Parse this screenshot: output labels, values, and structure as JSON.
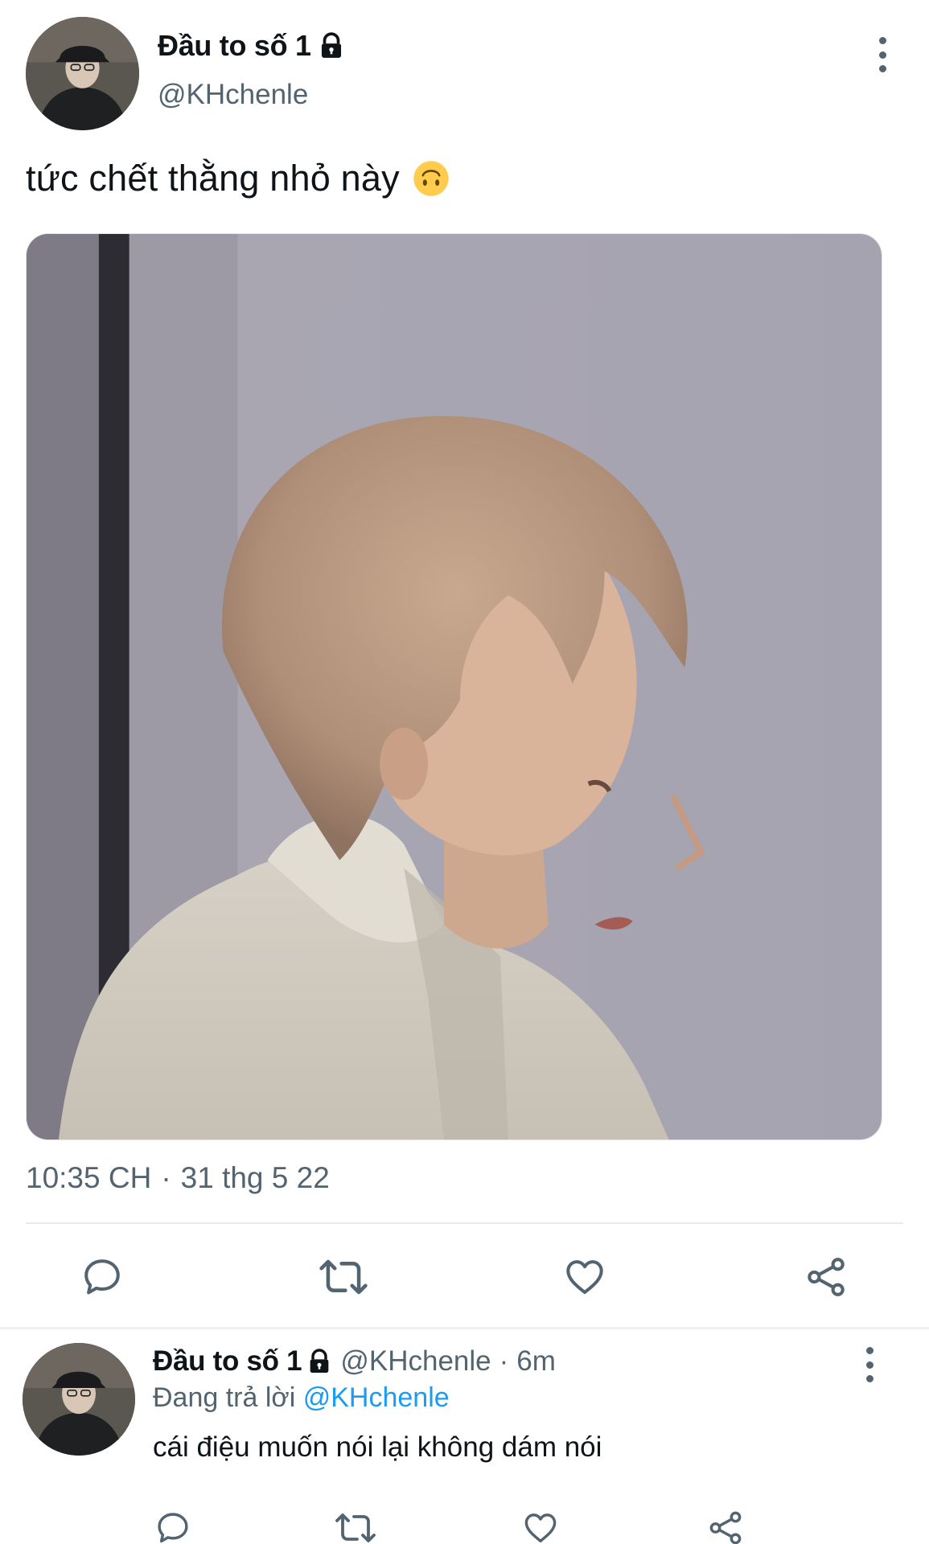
{
  "tweet": {
    "author": {
      "display_name": "Đầu to số 1",
      "handle": "@KHchenle",
      "protected_icon": "lock-icon",
      "avatar_icon": "avatar"
    },
    "text": "tức chết thằng nhỏ này",
    "emoji": "upside-down-face-emoji",
    "media_description_icon": "photo",
    "time": "10:35 CH",
    "separator": "·",
    "date": "31 thg 5 22",
    "actions": [
      {
        "name": "reply",
        "icon": "comment-icon"
      },
      {
        "name": "retweet",
        "icon": "retweet-icon"
      },
      {
        "name": "like",
        "icon": "heart-icon"
      },
      {
        "name": "share",
        "icon": "share-icon"
      }
    ]
  },
  "reply": {
    "author": {
      "display_name": "Đầu to số 1",
      "handle": "@KHchenle"
    },
    "dot": "·",
    "time_ago": "6m",
    "replying_prefix": "Đang trả lời",
    "replying_to": "@KHchenle",
    "text": "cái điệu muốn nói lại không dám nói"
  },
  "colors": {
    "text_primary": "#0f1419",
    "text_secondary": "#536471",
    "link": "#1d9bf0",
    "divider": "#e7eaed"
  }
}
